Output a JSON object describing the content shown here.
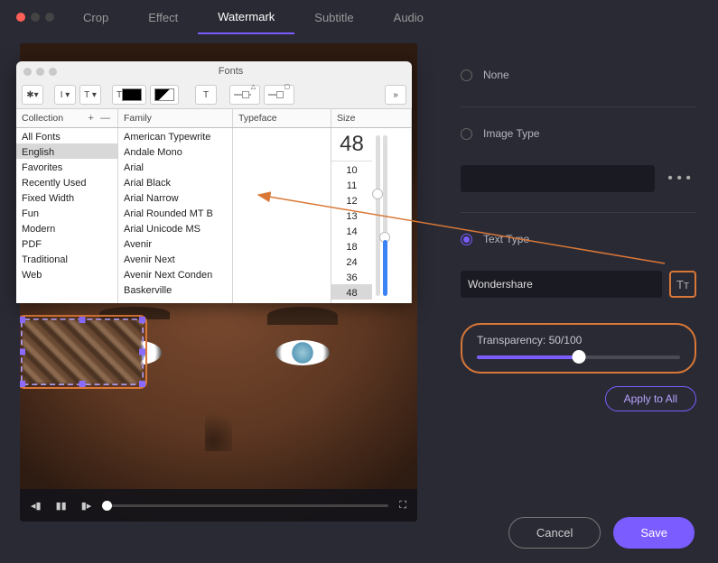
{
  "tabs": [
    "Crop",
    "Effect",
    "Watermark",
    "Subtitle",
    "Audio"
  ],
  "active_tab": 2,
  "fonts_panel": {
    "title": "Fonts",
    "headers": {
      "collection": "Collection",
      "family": "Family",
      "typeface": "Typeface",
      "size": "Size",
      "add": "+  —"
    },
    "collections": [
      "All Fonts",
      "English",
      "Favorites",
      "Recently Used",
      "Fixed Width",
      "Fun",
      "Modern",
      "PDF",
      "Traditional",
      "Web"
    ],
    "selected_collection": "English",
    "families": [
      "American Typewrite",
      "Andale Mono",
      "Arial",
      "Arial Black",
      "Arial Narrow",
      "Arial Rounded MT B",
      "Arial Unicode MS",
      "Avenir",
      "Avenir Next",
      "Avenir Next Conden",
      "Baskerville"
    ],
    "sizes": [
      "10",
      "11",
      "12",
      "13",
      "14",
      "18",
      "24",
      "36",
      "48"
    ],
    "current_size": "48",
    "toolbar_glyphs": {
      "gear": "✱",
      "underline_dd": "I ▾",
      "strike_dd": "T ▾",
      "t": "T",
      "t2": "T",
      "more": "»"
    }
  },
  "right_panel": {
    "none_label": "None",
    "image_type_label": "Image Type",
    "text_type_label": "Text Type",
    "text_value": "Wondershare",
    "tt_icon": "Tᴛ",
    "transparency_label": "Transparency: 50/100",
    "transparency_pct": 50,
    "apply_label": "Apply to All",
    "ellipsis": "• • •"
  },
  "player": {
    "prev": "◂▮",
    "pause": "▮▮",
    "next": "▮▸",
    "fullscreen": "⛶"
  },
  "footer": {
    "cancel": "Cancel",
    "save": "Save"
  },
  "colors": {
    "accent": "#7b5cff",
    "highlight": "#d97736"
  }
}
